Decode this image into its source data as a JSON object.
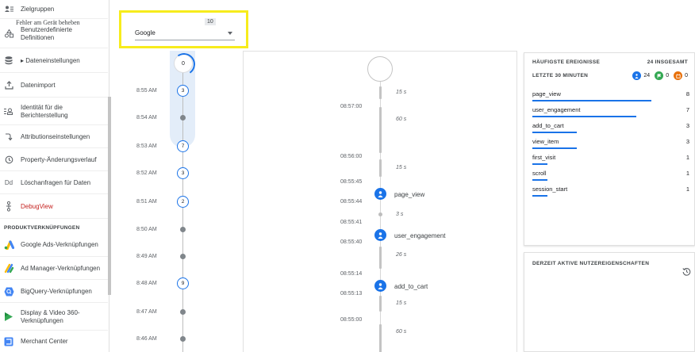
{
  "sidebar": {
    "items": [
      {
        "label": "Zielgruppen",
        "icon": "audience-icon"
      },
      {
        "label": "Benutzerdefinierte Definitionen",
        "icon": "custom-definitions-icon"
      },
      {
        "label": "▸ Dateneinstellungen",
        "icon": "database-icon"
      },
      {
        "label": "Datenimport",
        "icon": "upload-icon"
      },
      {
        "label": "Identität für die Berichterstellung",
        "icon": "identity-icon"
      },
      {
        "label": "Attributionseinstellungen",
        "icon": "attribution-icon"
      },
      {
        "label": "Property-Änderungsverlauf",
        "icon": "history-icon"
      },
      {
        "label": "Löschanfragen für Daten",
        "icon": "delete-data-icon"
      },
      {
        "label": "DebugView",
        "icon": "debug-icon"
      },
      {
        "label": "Google Ads-Verknüpfungen",
        "icon": "google-ads-icon"
      },
      {
        "label": "Ad Manager-Verknüpfungen",
        "icon": "ad-manager-icon"
      },
      {
        "label": "BigQuery-Verknüpfungen",
        "icon": "bigquery-icon"
      },
      {
        "label": "Display & Video 360-Verknüpfungen",
        "icon": "dv360-icon"
      },
      {
        "label": "Merchant Center",
        "icon": "merchant-center-icon"
      }
    ],
    "section_label": "PRODUKTVERKNÜPFUNGEN",
    "delete_icon_text": "Dd"
  },
  "device": {
    "title": "Fehler am Gerät beheben",
    "count": "10",
    "selected": "Google"
  },
  "minutes": {
    "top_count": "0",
    "rows": [
      {
        "time": "8:55 AM",
        "count": "3"
      },
      {
        "time": "8:54 AM",
        "count": ""
      },
      {
        "time": "8:53 AM",
        "count": "7"
      },
      {
        "time": "8:52 AM",
        "count": "3"
      },
      {
        "time": "8:51 AM",
        "count": "2"
      },
      {
        "time": "8:50 AM",
        "count": ""
      },
      {
        "time": "8:49 AM",
        "count": ""
      },
      {
        "time": "8:48 AM",
        "count": "9"
      },
      {
        "time": "8:47 AM",
        "count": ""
      },
      {
        "time": "8:46 AM",
        "count": ""
      }
    ]
  },
  "seconds": {
    "times": [
      "08:57:00",
      "08:56:00",
      "08:55:45",
      "08:55:44",
      "08:55:41",
      "08:55:40",
      "08:55:14",
      "08:55:13",
      "08:55:00"
    ],
    "durations": [
      "15 s",
      "60 s",
      "15 s",
      "3 s",
      "26 s",
      "15 s",
      "60 s"
    ],
    "events": [
      "page_view",
      "user_engagement",
      "add_to_cart"
    ]
  },
  "events_card": {
    "title": "HÄUFIGSTE EREIGNISSE",
    "total": "24 INSGESAMT",
    "subtitle": "LETZTE 30 MINUTEN",
    "stats": [
      {
        "value": "24",
        "color": "#1a73e8",
        "icon": "event-icon"
      },
      {
        "value": "0",
        "color": "#34a853",
        "icon": "conversion-flag-icon"
      },
      {
        "value": "0",
        "color": "#e8710a",
        "icon": "error-icon"
      }
    ],
    "rows": [
      {
        "name": "page_view",
        "count": "8",
        "fraction": 1.0
      },
      {
        "name": "user_engagement",
        "count": "7",
        "fraction": 0.875
      },
      {
        "name": "add_to_cart",
        "count": "3",
        "fraction": 0.375
      },
      {
        "name": "view_item",
        "count": "3",
        "fraction": 0.375
      },
      {
        "name": "first_visit",
        "count": "1",
        "fraction": 0.125
      },
      {
        "name": "scroll",
        "count": "1",
        "fraction": 0.125
      },
      {
        "name": "session_start",
        "count": "1",
        "fraction": 0.125
      }
    ]
  },
  "user_props_card": {
    "title": "DERZEIT AKTIVE NUTZEREIGENSCHAFTEN"
  }
}
